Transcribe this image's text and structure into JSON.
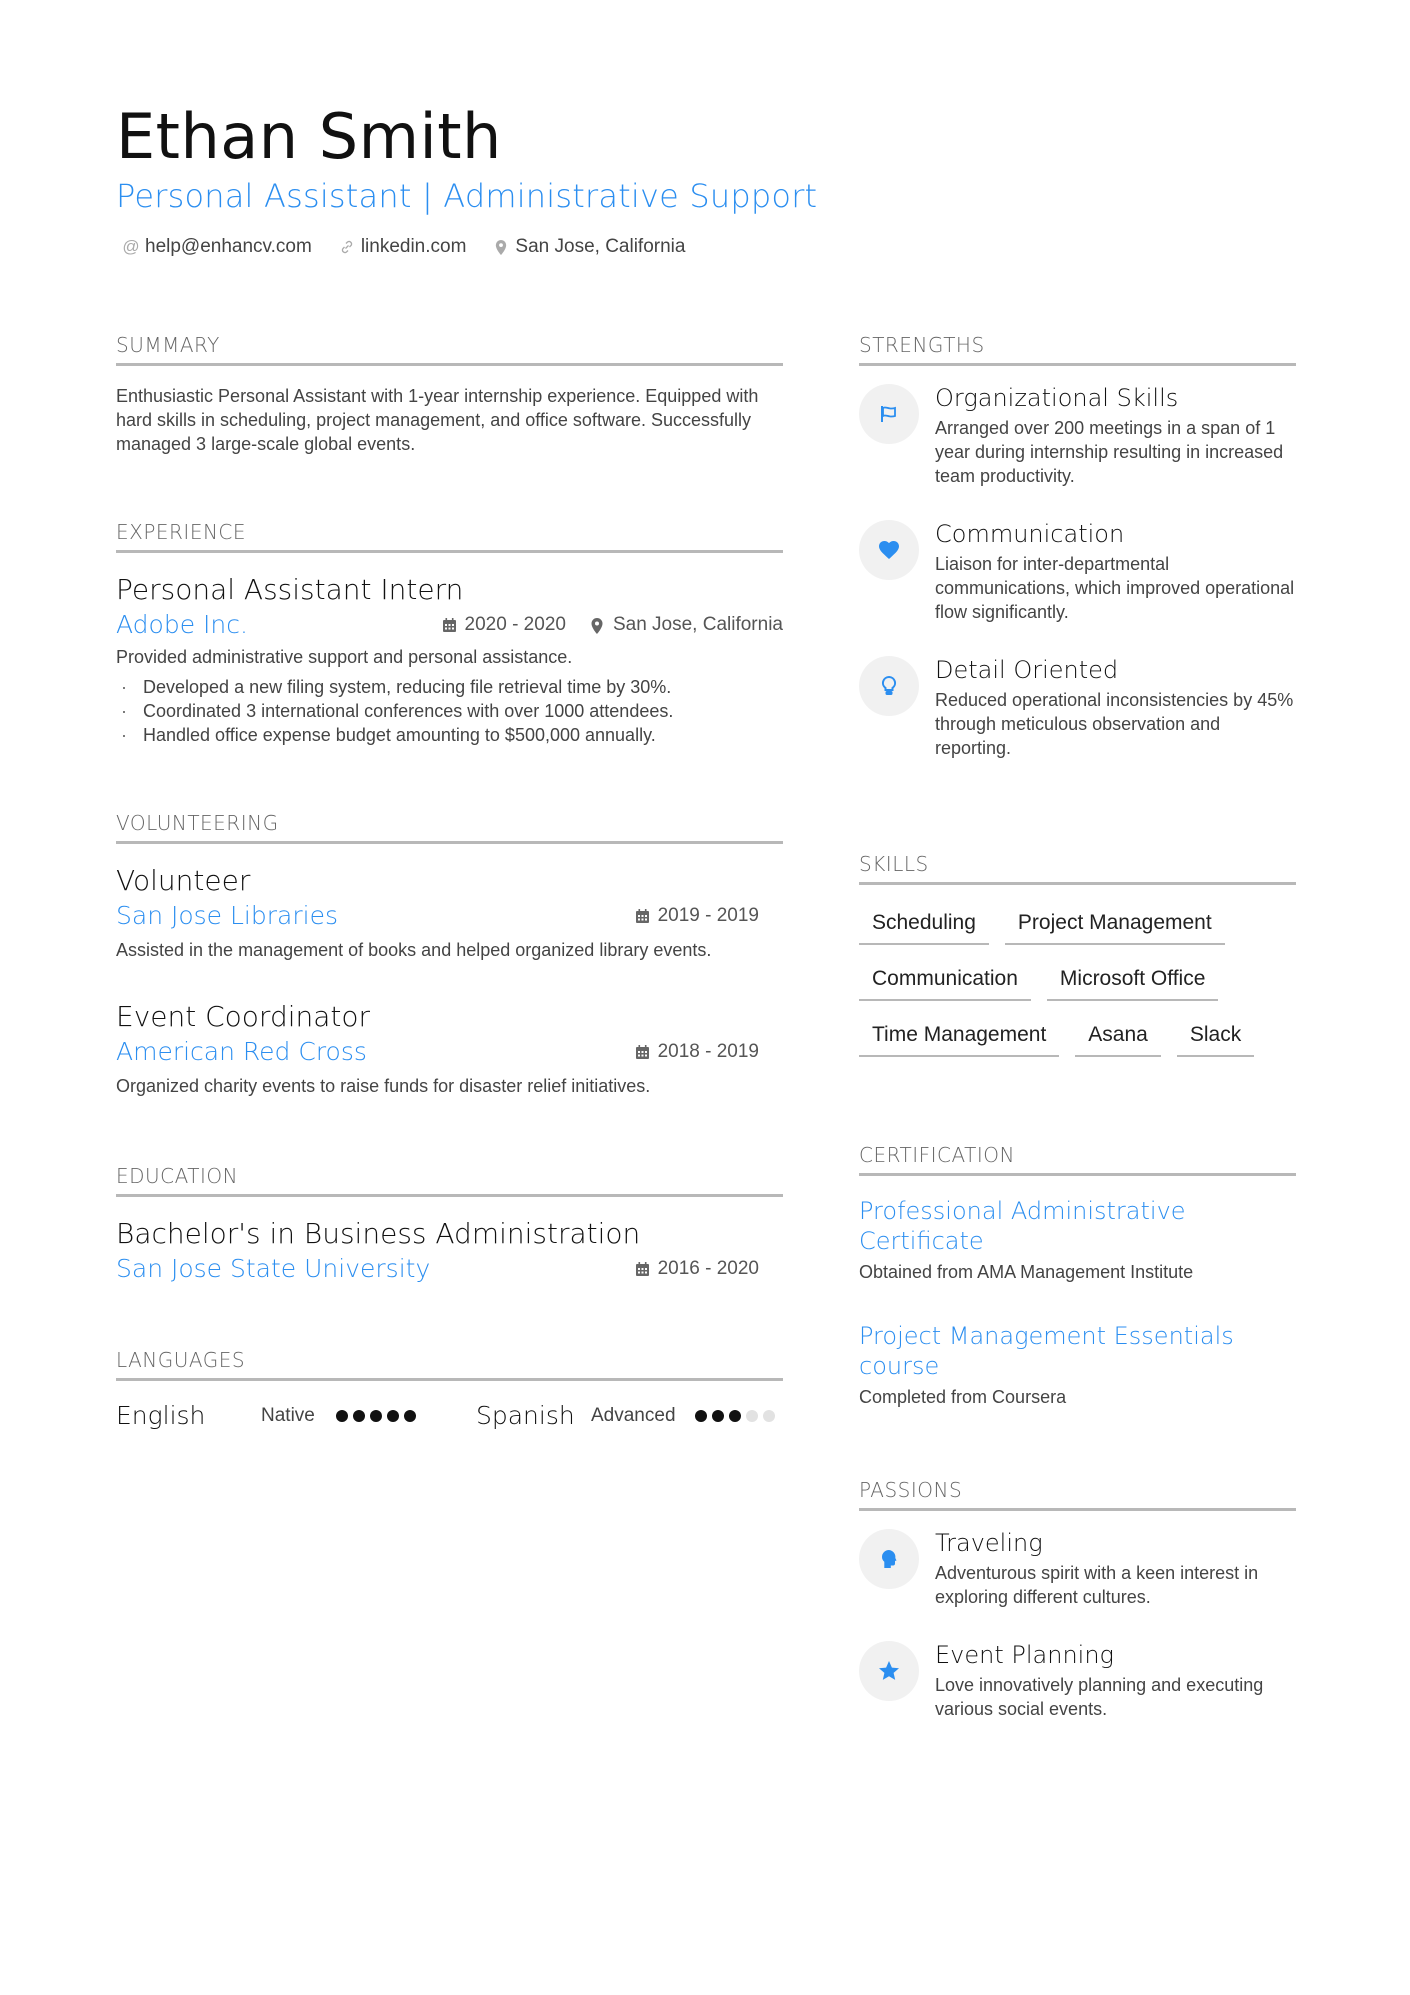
{
  "header": {
    "name": "Ethan Smith",
    "title": "Personal Assistant | Administrative Support",
    "contacts": [
      {
        "icon": "at-icon",
        "text": "help@enhancv.com"
      },
      {
        "icon": "link-icon",
        "text": "linkedin.com"
      },
      {
        "icon": "location-icon",
        "text": "San Jose, California"
      }
    ]
  },
  "summary": {
    "heading": "Summary",
    "text": "Enthusiastic Personal Assistant with 1-year internship experience. Equipped with hard skills in scheduling, project management, and office software. Successfully managed 3 large-scale global events."
  },
  "experience": {
    "heading": "Experience",
    "items": [
      {
        "role": "Personal Assistant Intern",
        "company": "Adobe Inc.",
        "dates": "2020 - 2020",
        "location": "San Jose, California",
        "description": "Provided administrative support and personal assistance.",
        "bullets": [
          "Developed a new filing system, reducing file retrieval time by 30%.",
          "Coordinated 3 international conferences with over 1000 attendees.",
          "Handled office expense budget amounting to $500,000 annually."
        ]
      }
    ]
  },
  "volunteering": {
    "heading": "Volunteering",
    "items": [
      {
        "role": "Volunteer",
        "org": "San Jose Libraries",
        "dates": "2019 - 2019",
        "description": "Assisted in the management of books and helped organized library events."
      },
      {
        "role": "Event Coordinator",
        "org": "American Red Cross",
        "dates": "2018 - 2019",
        "description": "Organized charity events to raise funds for disaster relief initiatives."
      }
    ]
  },
  "education": {
    "heading": "Education",
    "items": [
      {
        "degree": "Bachelor's in Business Administration",
        "school": "San Jose State University",
        "dates": "2016 - 2020"
      }
    ]
  },
  "languages": {
    "heading": "Languages",
    "items": [
      {
        "name": "English",
        "level": "Native",
        "rating": 5,
        "max": 5
      },
      {
        "name": "Spanish",
        "level": "Advanced",
        "rating": 3,
        "max": 5
      }
    ]
  },
  "strengths": {
    "heading": "Strengths",
    "items": [
      {
        "icon": "flag-icon",
        "title": "Organizational Skills",
        "description": "Arranged over 200 meetings in a span of 1 year during internship resulting in increased team productivity."
      },
      {
        "icon": "heart-icon",
        "title": "Communication",
        "description": "Liaison for inter-departmental communications, which improved operational flow significantly."
      },
      {
        "icon": "lightbulb-icon",
        "title": "Detail Oriented",
        "description": "Reduced operational inconsistencies by 45% through meticulous observation and reporting."
      }
    ]
  },
  "skills": {
    "heading": "Skills",
    "items": [
      "Scheduling",
      "Project Management",
      "Communication",
      "Microsoft Office",
      "Time Management",
      "Asana",
      "Slack"
    ]
  },
  "certification": {
    "heading": "Certification",
    "items": [
      {
        "title": "Professional Administrative Certificate",
        "description": "Obtained from AMA Management Institute"
      },
      {
        "title": "Project Management Essentials course",
        "description": "Completed from Coursera"
      }
    ]
  },
  "passions": {
    "heading": "Passions",
    "items": [
      {
        "icon": "head-icon",
        "title": "Traveling",
        "description": "Adventurous spirit with a keen interest in exploring different cultures."
      },
      {
        "icon": "star-icon",
        "title": "Event Planning",
        "description": "Love innovatively planning and executing various social events."
      }
    ]
  },
  "colors": {
    "accent": "#2b8ef0",
    "rule": "#b8b8b8",
    "icon_bg": "#f1f1f1"
  }
}
